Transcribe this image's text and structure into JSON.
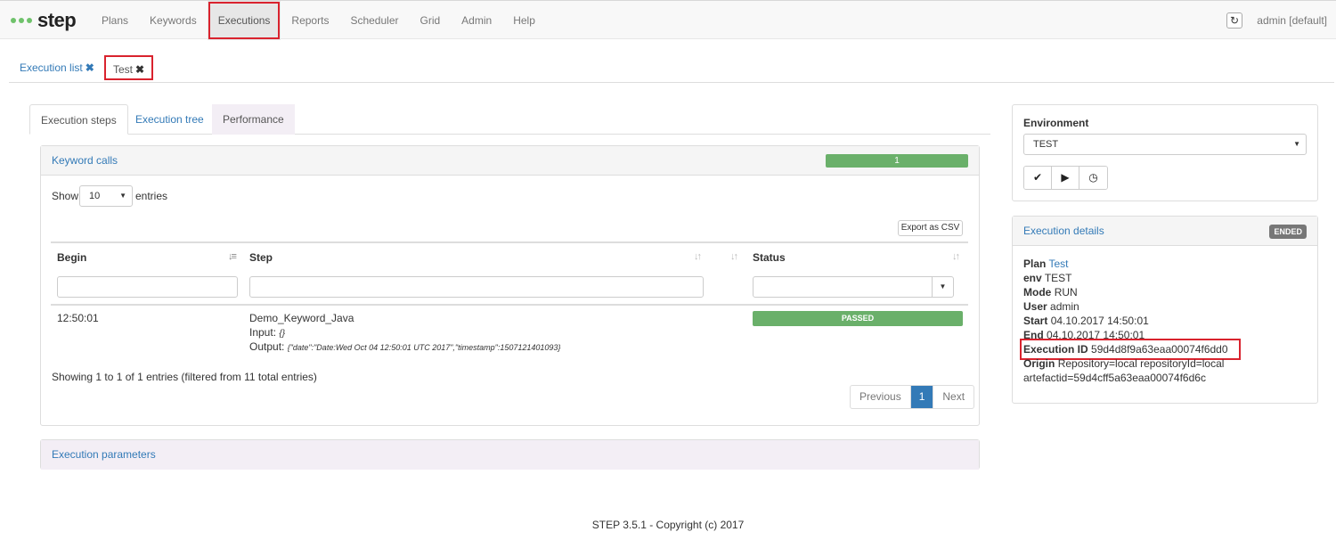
{
  "header": {
    "brand": "step",
    "nav": [
      "Plans",
      "Keywords",
      "Executions",
      "Reports",
      "Scheduler",
      "Grid",
      "Admin",
      "Help"
    ],
    "active_nav": "Executions",
    "refresh_icon": "refresh-icon",
    "user": "admin [default]"
  },
  "page_tabs": [
    {
      "label": "Execution list",
      "close": "✖"
    },
    {
      "label": "Test",
      "close": "✖"
    }
  ],
  "sub_tabs": [
    "Execution steps",
    "Execution tree",
    "Performance"
  ],
  "keyword_calls": {
    "title": "Keyword calls",
    "progress": "1",
    "show_label": "Show",
    "entries_value": "10",
    "entries_label": "entries",
    "export_button": "Export as CSV",
    "columns": [
      "Begin",
      "Step",
      "Status"
    ],
    "rows": [
      {
        "begin": "12:50:01",
        "step": "Demo_Keyword_Java",
        "input_label": "Input:",
        "input_value": "{}",
        "output_label": "Output:",
        "output_value": "{\"date\":\"Date:Wed Oct 04 12:50:01 UTC 2017\",\"timestamp\":1507121401093}",
        "status": "PASSED"
      }
    ],
    "info": "Showing 1 to 1 of 1 entries (filtered from 11 total entries)",
    "pagination": {
      "previous": "Previous",
      "current": "1",
      "next": "Next"
    }
  },
  "execution_parameters": {
    "title": "Execution parameters"
  },
  "environment": {
    "title": "Environment",
    "selected": "TEST",
    "buttons": [
      "check-icon",
      "play-icon",
      "clock-icon"
    ]
  },
  "execution_details": {
    "title": "Execution details",
    "status_badge": "ENDED",
    "plan_label": "Plan",
    "plan_value": "Test",
    "env_label": "env",
    "env_value": "TEST",
    "mode_label": "Mode",
    "mode_value": "RUN",
    "user_label": "User",
    "user_value": "admin",
    "start_label": "Start",
    "start_value": "04.10.2017 14:50:01",
    "end_label": "End",
    "end_value": "04.10.2017 14:50:01",
    "execution_id_label": "Execution ID",
    "execution_id_value": "59d4d8f9a63eaa00074f6dd0",
    "origin_label": "Origin",
    "origin_value": "Repository=local repositoryId=local",
    "origin_value2": "artefactid=59d4cff5a63eaa00074f6d6c"
  },
  "footer": "STEP 3.5.1 - Copyright (c) 2017"
}
